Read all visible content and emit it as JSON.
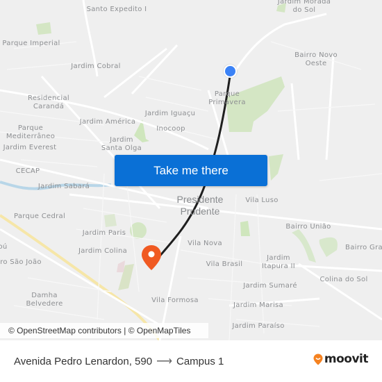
{
  "map": {
    "labels": [
      {
        "text": "Santo Expedito I",
        "kind": "neighborhood"
      },
      {
        "text": "Jardim Morada do Sol",
        "kind": "neighborhood"
      },
      {
        "text": "Parque Imperial",
        "kind": "neighborhood"
      },
      {
        "text": "Bairro Novo Oeste",
        "kind": "neighborhood"
      },
      {
        "text": "Jardim Cobral",
        "kind": "neighborhood"
      },
      {
        "text": "Parque Primavera",
        "kind": "neighborhood"
      },
      {
        "text": "Residencial Carandá",
        "kind": "neighborhood"
      },
      {
        "text": "Jardim Iguaçu",
        "kind": "neighborhood"
      },
      {
        "text": "Jardim América",
        "kind": "neighborhood"
      },
      {
        "text": "Inocoop",
        "kind": "neighborhood"
      },
      {
        "text": "Parque Mediterrâneo",
        "kind": "neighborhood"
      },
      {
        "text": "Jardim Santa Olga",
        "kind": "neighborhood"
      },
      {
        "text": "Jardim Everest",
        "kind": "neighborhood"
      },
      {
        "text": "CECAP",
        "kind": "neighborhood"
      },
      {
        "text": "Jardim Sabará",
        "kind": "neighborhood"
      },
      {
        "text": "Presidente Prudente",
        "kind": "city"
      },
      {
        "text": "Vila Luso",
        "kind": "neighborhood"
      },
      {
        "text": "Parque Cedral",
        "kind": "neighborhood"
      },
      {
        "text": "Bairro União",
        "kind": "neighborhood"
      },
      {
        "text": "Jardim Paris",
        "kind": "neighborhood"
      },
      {
        "text": "Vila Nova",
        "kind": "neighborhood"
      },
      {
        "text": "Bairro Gra",
        "kind": "neighborhood"
      },
      {
        "text": "Jardim Colina",
        "kind": "neighborhood"
      },
      {
        "text": "Jardim Itapura II",
        "kind": "neighborhood"
      },
      {
        "text": "Vila Brasil",
        "kind": "neighborhood"
      },
      {
        "text": "ro São João",
        "kind": "neighborhood"
      },
      {
        "text": "Colina do Sol",
        "kind": "neighborhood"
      },
      {
        "text": "Jardim Sumaré",
        "kind": "neighborhood"
      },
      {
        "text": "Damha Belvedere",
        "kind": "neighborhood"
      },
      {
        "text": "Vila Formosa",
        "kind": "neighborhood"
      },
      {
        "text": "Jardim Marisa",
        "kind": "neighborhood"
      },
      {
        "text": "Jardim Paraíso",
        "kind": "neighborhood"
      },
      {
        "text": "oú",
        "kind": "neighborhood"
      }
    ],
    "route_color": "#1f1f1f",
    "origin_color": "#3b82f6",
    "destination_color": "#f05a22",
    "attribution": "© OpenStreetMap contributors | © OpenMapTiles"
  },
  "cta": {
    "label": "Take me there",
    "color": "#0a70d6"
  },
  "footer": {
    "origin": "Avenida Pedro Lenardon, 590",
    "arrow": "⟶",
    "destination": "Campus 1",
    "brand": "moovit",
    "brand_color": "#f58220"
  }
}
